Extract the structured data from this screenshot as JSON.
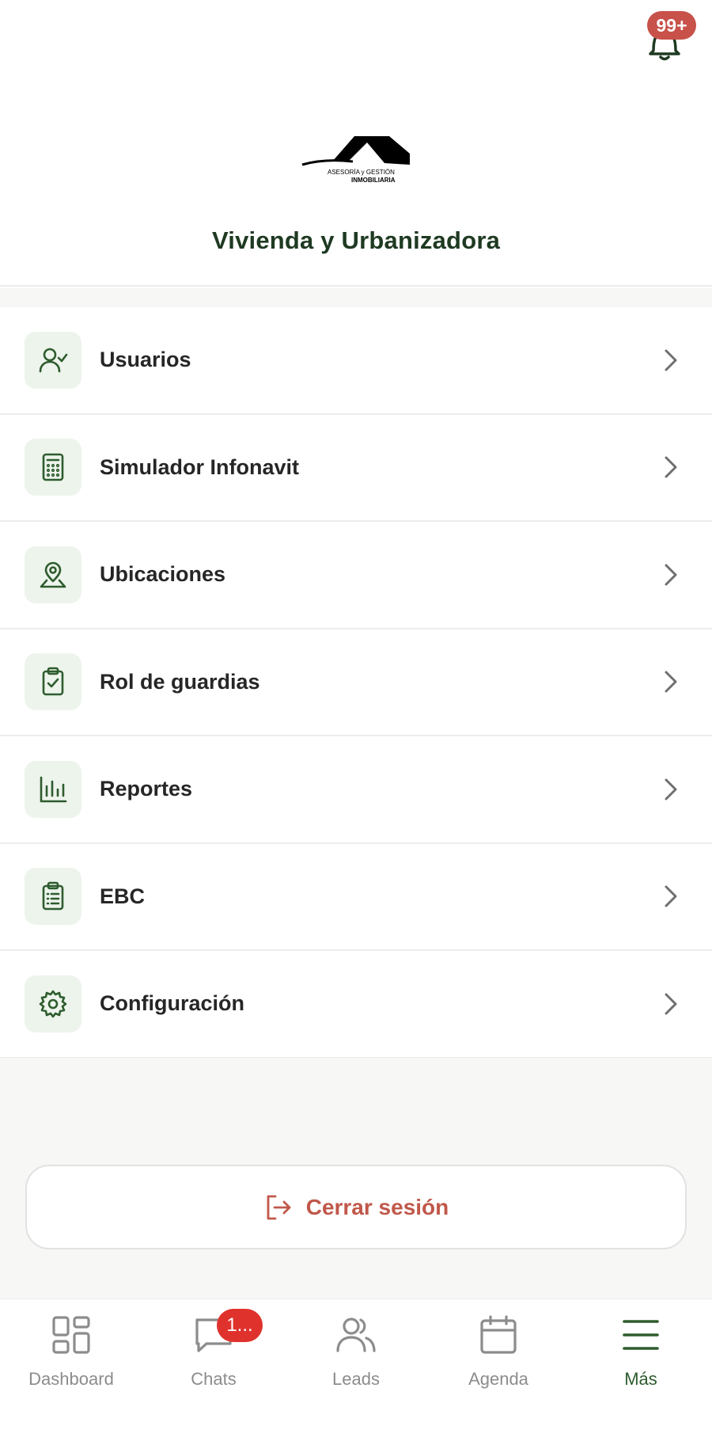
{
  "header": {
    "notifications_badge": "99+",
    "logo_line1": "ASESORÍA y GESTIÓN",
    "logo_line2": "INMOBILIARIA",
    "company_name": "Vivienda y Urbanizadora"
  },
  "menu": {
    "items": [
      {
        "label": "Usuarios",
        "icon": "user-check-icon"
      },
      {
        "label": "Simulador Infonavit",
        "icon": "calculator-icon"
      },
      {
        "label": "Ubicaciones",
        "icon": "map-pin-icon"
      },
      {
        "label": "Rol de guardias",
        "icon": "clipboard-check-icon"
      },
      {
        "label": "Reportes",
        "icon": "bar-chart-icon"
      },
      {
        "label": "EBC",
        "icon": "clipboard-list-icon"
      },
      {
        "label": "Configuración",
        "icon": "gear-icon"
      }
    ]
  },
  "logout": {
    "label": "Cerrar sesión",
    "icon": "logout-icon"
  },
  "tabbar": {
    "tabs": [
      {
        "label": "Dashboard",
        "icon": "dashboard-icon"
      },
      {
        "label": "Chats",
        "icon": "chat-icon",
        "badge": "1..."
      },
      {
        "label": "Leads",
        "icon": "users-icon"
      },
      {
        "label": "Agenda",
        "icon": "calendar-icon"
      },
      {
        "label": "Más",
        "icon": "menu-icon"
      }
    ],
    "active": "Más"
  },
  "colors": {
    "accent_green": "#2e5c2e",
    "icon_bg": "#edf4ec",
    "logout_red": "#c0584a",
    "badge_red": "#e0322d",
    "notif_badge": "#c8514a"
  }
}
